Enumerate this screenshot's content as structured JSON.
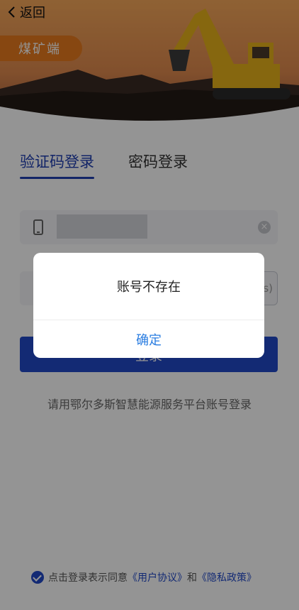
{
  "header": {
    "back_label": "返回",
    "role_badge": "煤矿端"
  },
  "tabs": [
    {
      "label": "验证码登录",
      "active": true
    },
    {
      "label": "密码登录",
      "active": false
    }
  ],
  "form": {
    "phone_value_masked": true,
    "code_button_partial": "s)",
    "login_label": "登录"
  },
  "hint_text": "请用鄂尔多斯智慧能源服务平台账号登录",
  "agreement": {
    "prefix": "点击登录表示同意",
    "user_agreement": "《用户协议》",
    "and": "和",
    "privacy_policy": "《隐私政策》"
  },
  "dialog": {
    "message": "账号不存在",
    "confirm_label": "确定"
  },
  "colors": {
    "primary": "#2249c8",
    "badge": "#e87a1e",
    "dialog_button": "#2a7de1"
  }
}
